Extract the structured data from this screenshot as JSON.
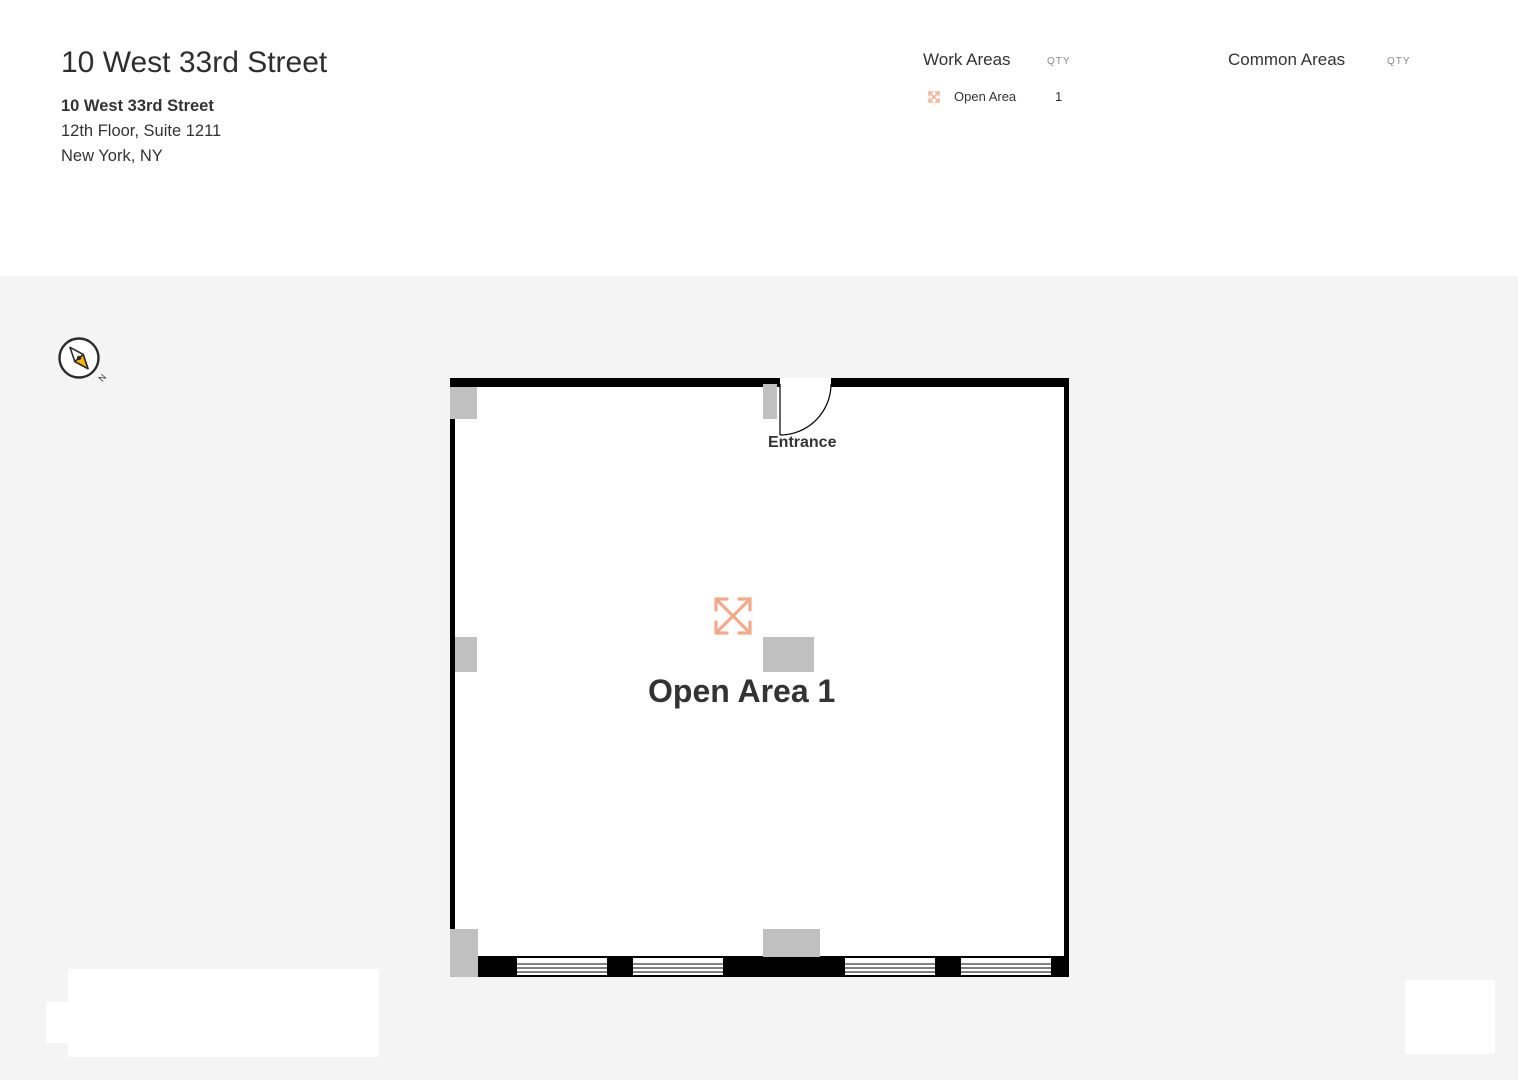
{
  "header": {
    "title": "10 West 33rd Street",
    "address": {
      "name": "10 West 33rd Street",
      "line1": "12th Floor, Suite 1211",
      "line2": "New York, NY"
    }
  },
  "legend": {
    "work_areas": {
      "title": "Work Areas",
      "qty_label": "QTY",
      "items": [
        {
          "label": "Open Area",
          "qty": "1",
          "icon": "expand-arrows-icon"
        }
      ]
    },
    "common_areas": {
      "title": "Common Areas",
      "qty_label": "QTY",
      "items": []
    }
  },
  "compass": {
    "icon": "compass-icon",
    "label": "N"
  },
  "floorplan": {
    "entrance_label": "Entrance",
    "areas": [
      {
        "label": "Open Area 1",
        "icon": "expand-arrows-icon"
      }
    ]
  },
  "colors": {
    "accent": "#f4a98a",
    "wall": "#000000",
    "column": "#c0c0c0",
    "background": "#f4f4f4",
    "compass_needle": "#f5b400"
  }
}
